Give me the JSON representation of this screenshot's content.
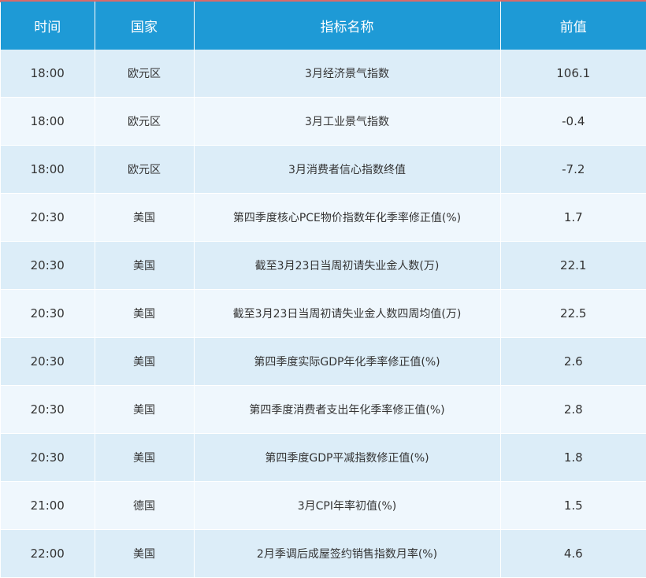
{
  "colors": {
    "header_bg": "#1e9ad6",
    "row_odd_bg": "#dcedf8",
    "row_even_bg": "#eff7fd",
    "accent": "#d96a6a"
  },
  "headers": {
    "time": "时间",
    "country": "国家",
    "name": "指标名称",
    "prev": "前值"
  },
  "rows": [
    {
      "time": "18:00",
      "country": "欧元区",
      "name": "3月经济景气指数",
      "prev": "106.1"
    },
    {
      "time": "18:00",
      "country": "欧元区",
      "name": "3月工业景气指数",
      "prev": "-0.4"
    },
    {
      "time": "18:00",
      "country": "欧元区",
      "name": "3月消费者信心指数终值",
      "prev": "-7.2"
    },
    {
      "time": "20:30",
      "country": "美国",
      "name": "第四季度核心PCE物价指数年化季率修正值(%)",
      "prev": "1.7"
    },
    {
      "time": "20:30",
      "country": "美国",
      "name": "截至3月23日当周初请失业金人数(万)",
      "prev": "22.1"
    },
    {
      "time": "20:30",
      "country": "美国",
      "name": "截至3月23日当周初请失业金人数四周均值(万)",
      "prev": "22.5"
    },
    {
      "time": "20:30",
      "country": "美国",
      "name": "第四季度实际GDP年化季率修正值(%)",
      "prev": "2.6"
    },
    {
      "time": "20:30",
      "country": "美国",
      "name": "第四季度消费者支出年化季率修正值(%)",
      "prev": "2.8"
    },
    {
      "time": "20:30",
      "country": "美国",
      "name": "第四季度GDP平减指数修正值(%)",
      "prev": "1.8"
    },
    {
      "time": "21:00",
      "country": "德国",
      "name": "3月CPI年率初值(%)",
      "prev": "1.5"
    },
    {
      "time": "22:00",
      "country": "美国",
      "name": "2月季调后成屋签约销售指数月率(%)",
      "prev": "4.6"
    }
  ]
}
